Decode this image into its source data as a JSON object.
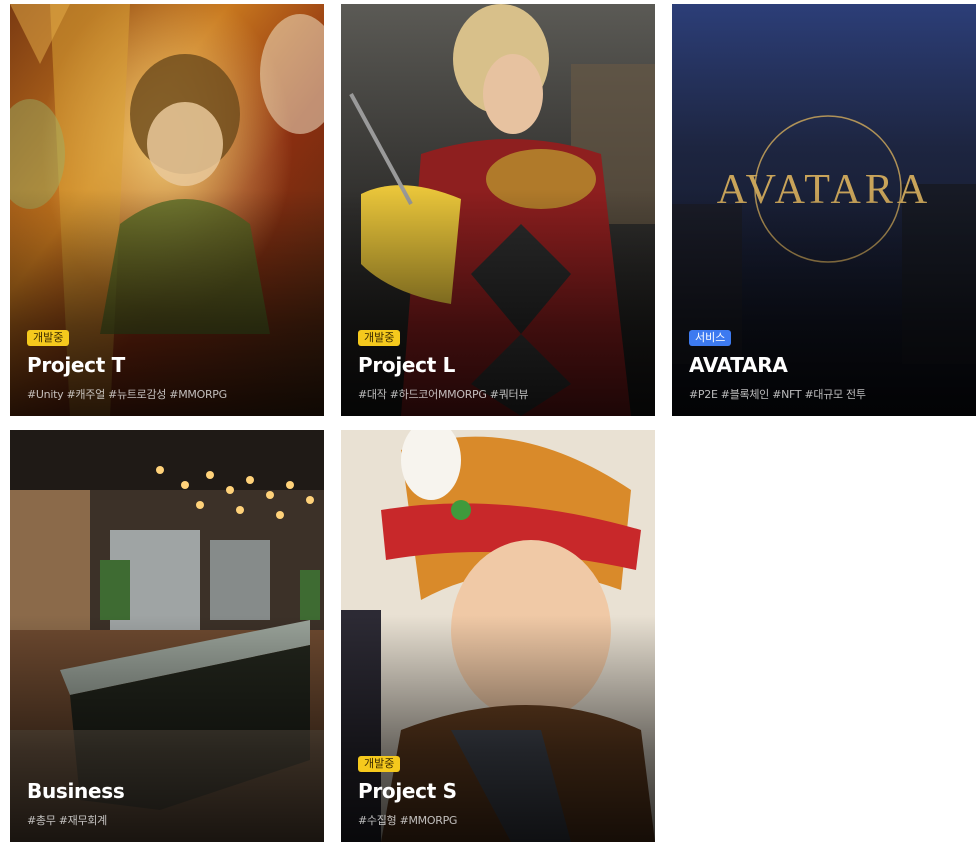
{
  "cards": [
    {
      "badge": "개발중",
      "badge_type": "dev",
      "title": "Project T",
      "tags": "#Unity #캐주얼 #뉴트로감성 #MMORPG"
    },
    {
      "badge": "개발중",
      "badge_type": "dev",
      "title": "Project L",
      "tags": "#대작 #하드코어MMORPG #쿼터뷰"
    },
    {
      "badge": "서비스",
      "badge_type": "service",
      "title": "AVATARA",
      "tags": "#P2E #블록체인 #NFT #대규모 전투",
      "logo_text": "AVATARA"
    },
    {
      "title": "Business",
      "tags": "#총무 #재무회계"
    },
    {
      "badge": "개발중",
      "badge_type": "dev",
      "title": "Project S",
      "tags": "#수집형 #MMORPG"
    }
  ],
  "colors": {
    "badge_dev": "#f5c91d",
    "badge_service": "#3d7af0",
    "avatara_gold": "#c9a45a"
  }
}
